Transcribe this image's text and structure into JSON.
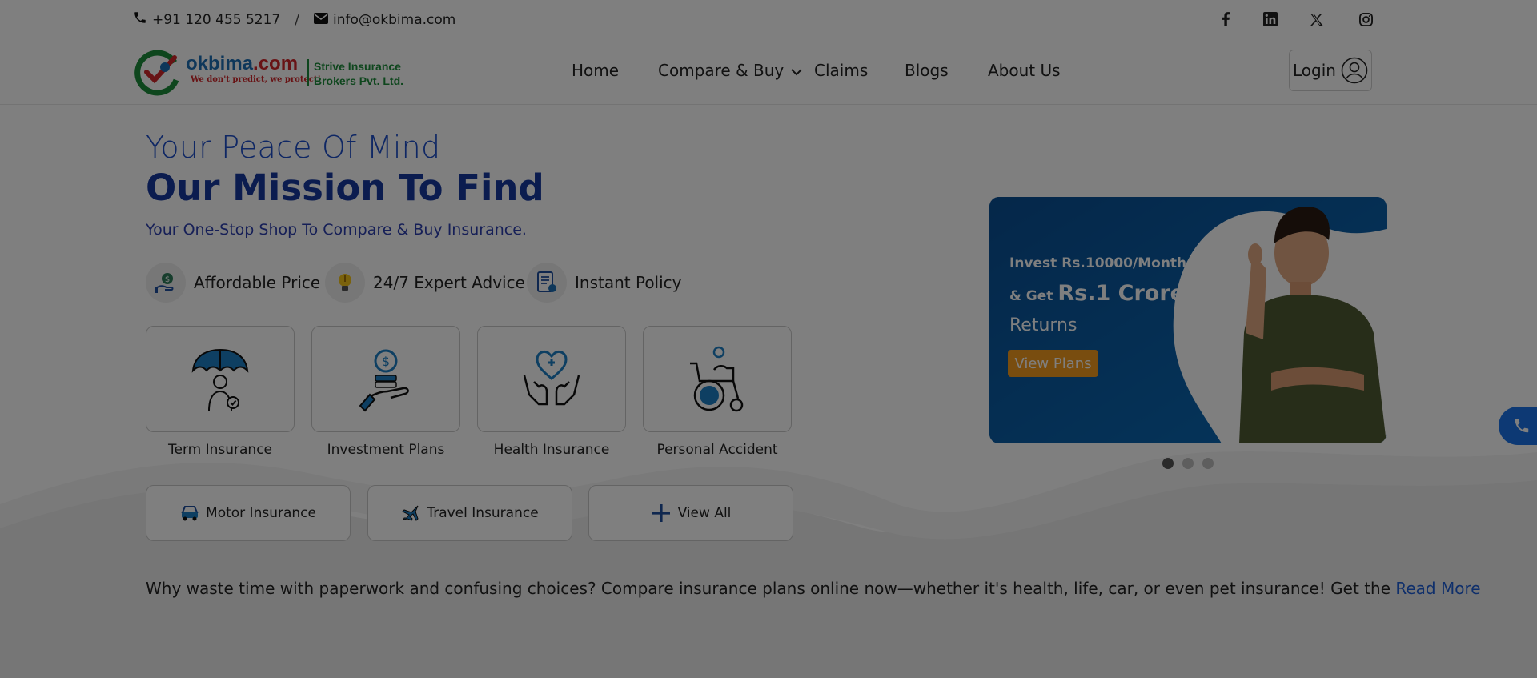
{
  "topbar": {
    "phone": "+91 120 455 5217",
    "separator": "/",
    "email": "info@okbima.com",
    "social_icons": [
      "facebook-icon",
      "linkedin-icon",
      "x-icon",
      "instagram-icon"
    ]
  },
  "header": {
    "logo": {
      "brand_main": "okbima",
      "brand_suffix": ".com",
      "tagline": "We don't predict, we protect!",
      "company_line1": "Strive Insurance",
      "company_line2": "Brokers Pvt. Ltd."
    },
    "nav": [
      "Home",
      "Compare & Buy",
      "Claims",
      "Blogs",
      "About Us"
    ],
    "login_label": "Login"
  },
  "hero": {
    "subtitle": "Your Peace Of Mind",
    "title": "Our Mission To Find",
    "tagline": "Your One-Stop Shop To Compare & Buy Insurance.",
    "features": [
      {
        "label": "Affordable Price",
        "icon": "money-hand-icon"
      },
      {
        "label": "24/7 Expert Advice",
        "icon": "lightbulb-icon"
      },
      {
        "label": "Instant Policy",
        "icon": "policy-document-icon"
      }
    ],
    "cards": [
      {
        "label": "Term Insurance",
        "icon": "umbrella-person-icon"
      },
      {
        "label": "Investment Plans",
        "icon": "coin-hand-icon"
      },
      {
        "label": "Health Insurance",
        "icon": "heart-hands-icon"
      },
      {
        "label": "Personal Accident",
        "icon": "wheelchair-icon"
      }
    ],
    "pills": [
      {
        "label": "Motor Insurance",
        "icon": "car-icon"
      },
      {
        "label": "Travel Insurance",
        "icon": "airplane-icon"
      },
      {
        "label": "View All",
        "icon": "plus-icon"
      }
    ],
    "paragraph": "Why waste time with paperwork and confusing choices? Compare insurance plans online now—whether it's health, life, car, or even pet insurance! Get the",
    "read_more": "Read More"
  },
  "banner": {
    "line1": "Invest Rs.10000/Month",
    "line2_prefix": "& Get",
    "line2_amount": "Rs.1 Crore",
    "line3": "Returns",
    "button": "View Plans",
    "slides_count": 3,
    "active_slide": 1
  },
  "colors": {
    "primary_blue": "#17399f",
    "accent_blue": "#1e4fc9",
    "banner_bg": "#0b5a9e",
    "banner_button": "#f39a1e",
    "call_button": "#1a73e8",
    "overlay": "rgba(0,0,0,0.5)"
  }
}
